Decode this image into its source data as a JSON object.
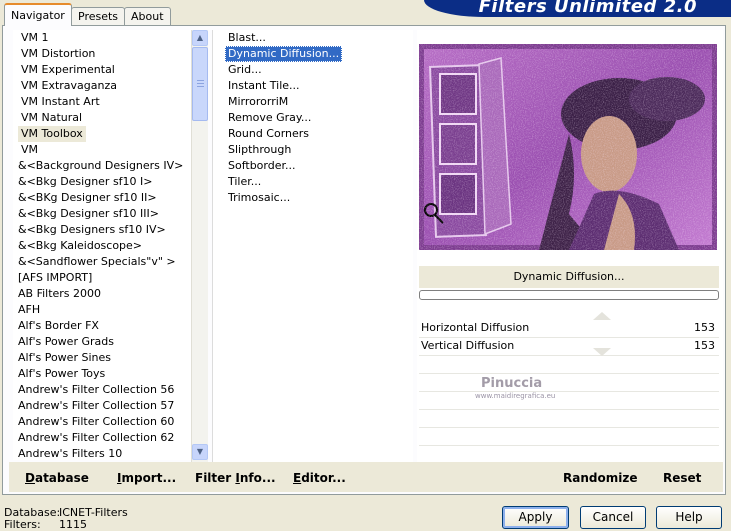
{
  "tabs": [
    {
      "label": "Navigator"
    },
    {
      "label": "Presets"
    },
    {
      "label": "About"
    }
  ],
  "app_title": "Filters Unlimited 2.0",
  "categories": [
    "VM 1",
    "VM Distortion",
    "VM Experimental",
    "VM Extravaganza",
    "VM Instant Art",
    "VM Natural",
    "VM Toolbox",
    "VM",
    "&<Background Designers IV>",
    "&<Bkg Designer sf10 I>",
    "&<BKg Designer sf10 II>",
    "&<Bkg Designer sf10 III>",
    "&<Bkg Designers sf10 IV>",
    "&<Bkg Kaleidoscope>",
    "&<Sandflower Specials\"v\" >",
    "[AFS IMPORT]",
    "AB Filters 2000",
    "AFH",
    "Alf's Border FX",
    "Alf's Power Grads",
    "Alf's Power Sines",
    "Alf's Power Toys",
    "Andrew's Filter Collection 56",
    "Andrew's Filter Collection 57",
    "Andrew's Filter Collection 60",
    "Andrew's Filter Collection 62",
    "Andrew's Filters 10"
  ],
  "filters": [
    "Blast...",
    "Dynamic Diffusion...",
    "Grid...",
    "Instant Tile...",
    "MirrororriM",
    "Remove Gray...",
    "Round Corners",
    "Slipthrough",
    "Softborder...",
    "Tiler...",
    "Trimosaic..."
  ],
  "selected_filter_name": "Dynamic Diffusion...",
  "params": [
    {
      "label": "Horizontal Diffusion",
      "value": "153",
      "fraction": 0.6
    },
    {
      "label": "Vertical Diffusion",
      "value": "153",
      "fraction": 0.6
    }
  ],
  "watermark": {
    "name": "Pinuccia",
    "site": "www.maidiregrafica.eu"
  },
  "toolbar": {
    "database": "Database",
    "import": "Import...",
    "filter_info": "Filter Info...",
    "editor": "Editor...",
    "randomize": "Randomize",
    "reset": "Reset"
  },
  "status": {
    "database_key": "Database:",
    "database_val": "ICNET-Filters",
    "filters_key": "Filters:",
    "filters_val": "1115"
  },
  "buttons": {
    "apply": "Apply",
    "cancel": "Cancel",
    "help": "Help"
  },
  "colors": {
    "banner": "#0b2d86",
    "selection": "#316ac5",
    "preview_purple": "#a65ab6"
  }
}
